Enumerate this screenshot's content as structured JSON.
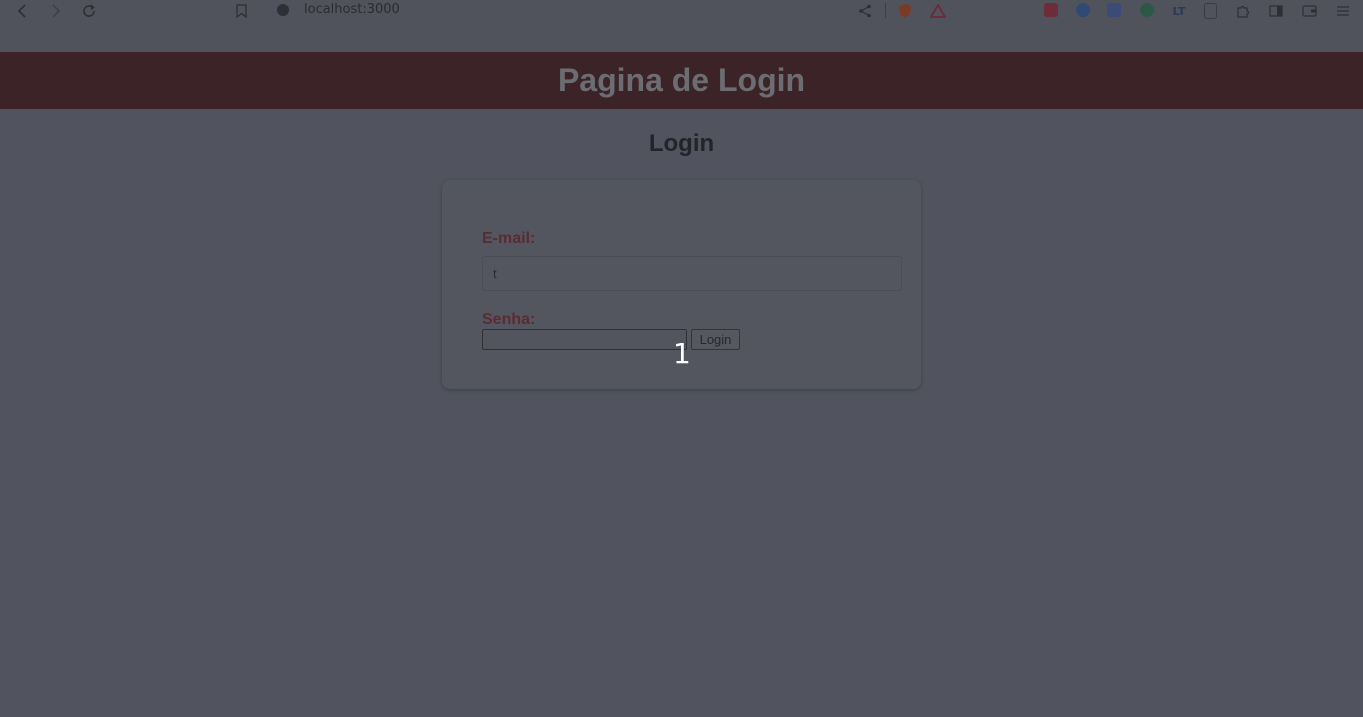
{
  "browser": {
    "url": "localhost:3000",
    "icons": {
      "back": "back-arrow-icon",
      "forward": "forward-arrow-icon",
      "reload": "reload-icon",
      "bookmark": "bookmark-icon",
      "site_info": "info-icon",
      "share": "share-icon",
      "extensions": [
        "brave-shield-icon",
        "triangle-alert-icon",
        "ext-red-icon",
        "ext-blue-globe-icon",
        "translate-icon",
        "grammarly-icon",
        "languagetool-icon",
        "page-icon",
        "puzzle-icon",
        "sidebar-icon",
        "wallet-icon",
        "menu-icon"
      ]
    }
  },
  "header": {
    "title": "Pagina de Login"
  },
  "main": {
    "title": "Login"
  },
  "form": {
    "email_label": "E-mail:",
    "email_value": "t",
    "password_label": "Senha:",
    "password_value": "",
    "login_button": "Login"
  },
  "overlay": {
    "step_number": "1"
  },
  "colors": {
    "header_bg": "#3c2328",
    "label_color": "#5a2b33",
    "page_bg": "#51545e"
  }
}
